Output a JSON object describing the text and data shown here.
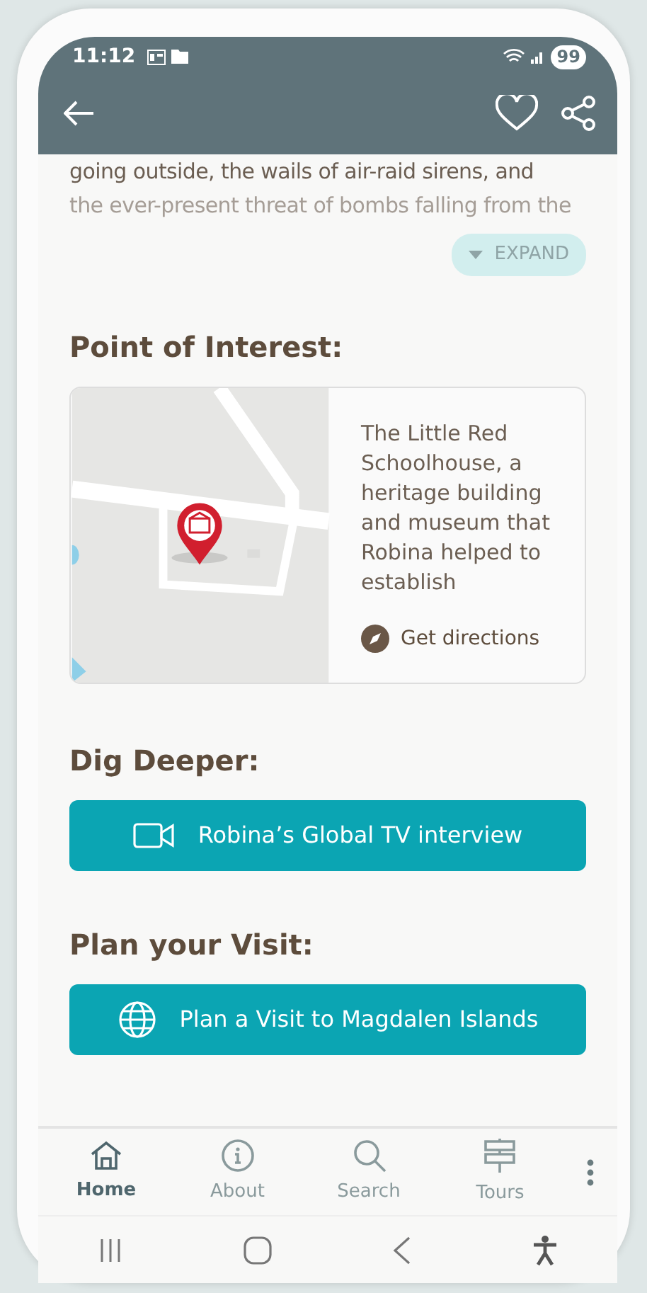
{
  "status_bar": {
    "time": "11:12",
    "battery": "99"
  },
  "story": {
    "lines": [
      "going outside, the wails of air-raid sirens, and",
      "the ever-present threat of bombs falling from the"
    ],
    "expand_label": "EXPAND",
    "expanded": false
  },
  "point_of_interest": {
    "heading": "Point of Interest:",
    "description": "The Little Red Schoolhouse, a heritage building and museum that Robina helped to establish",
    "directions_label": "Get directions"
  },
  "dig_deeper": {
    "heading": "Dig Deeper:",
    "button": "Robina’s Global TV interview"
  },
  "plan_visit": {
    "heading": "Plan your Visit:",
    "button": "Plan a Visit to Magdalen Islands"
  },
  "bottom_nav": [
    {
      "kind": "home",
      "label": "Home",
      "selected": true
    },
    {
      "kind": "about",
      "label": "About",
      "selected": false
    },
    {
      "kind": "search",
      "label": "Search",
      "selected": false
    },
    {
      "kind": "tours",
      "label": "Tours",
      "selected": false
    }
  ]
}
